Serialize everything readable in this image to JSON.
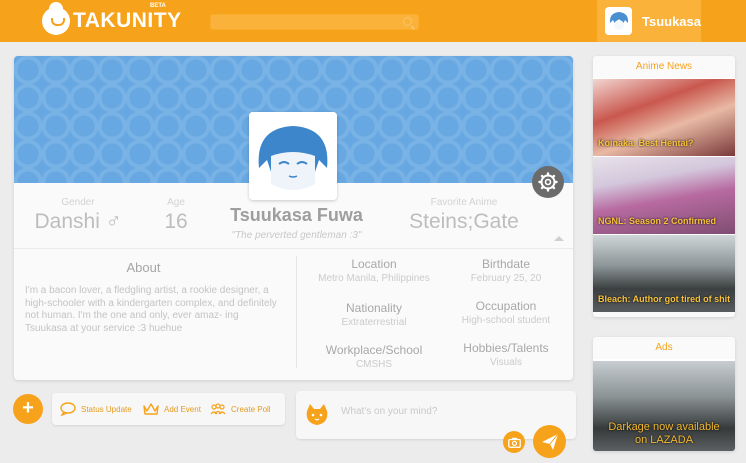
{
  "topbar": {
    "logo_text": "TAKUNITY",
    "logo_badge": "BETA",
    "search_placeholder": "",
    "user_name": "Tsuukasa"
  },
  "profile": {
    "gender_label": "Gender",
    "gender_value": "Danshi ♂",
    "age_label": "Age",
    "age_value": "16",
    "full_name": "Tsuukasa Fuwa",
    "tagline": "\"The perverted gentleman :3\"",
    "anime_label": "Favorite Anime",
    "anime_value": "Steins;Gate",
    "about_title": "About",
    "about_text": "I'm a bacon lover, a fledgling artist, a rookie designer, a high-schooler with a kindergarten complex, and definitely not human. I'm the one and only, ever amaz- ing Tsuukasa at your service :3 huehue",
    "info": {
      "location_label": "Location",
      "location_value": "Metro Manila, Philippines",
      "birthdate_label": "Birthdate",
      "birthdate_value": "February 25, 20",
      "nationality_label": "Nationality",
      "nationality_value": "Extraterrestrial",
      "occupation_label": "Occupation",
      "occupation_value": "High-school student",
      "workplace_label": "Workplace/School",
      "workplace_value": "CMSHS",
      "hobbies_label": "Hobbies/Talents",
      "hobbies_value": "Visuals"
    }
  },
  "composer": {
    "add_label": "+",
    "status_label": "Status Update",
    "event_label": "Add Event",
    "poll_label": "Create Poll",
    "placeholder": "What's on your mind?"
  },
  "sidebar": {
    "news_title": "Anime News",
    "news": [
      {
        "caption": "Koinaka: Best Hentai?"
      },
      {
        "caption": "NGNL: Season 2 Confirmed"
      },
      {
        "caption": "Bleach: Author got tired of shit"
      }
    ],
    "ads_title": "Ads",
    "ad_caption_line1": "Darkage now available",
    "ad_caption_line2": "on LAZADA"
  },
  "colors": {
    "accent": "#f7a21b",
    "cover": "#67a8e2",
    "panel": "#fafafa",
    "background": "#ececec"
  }
}
